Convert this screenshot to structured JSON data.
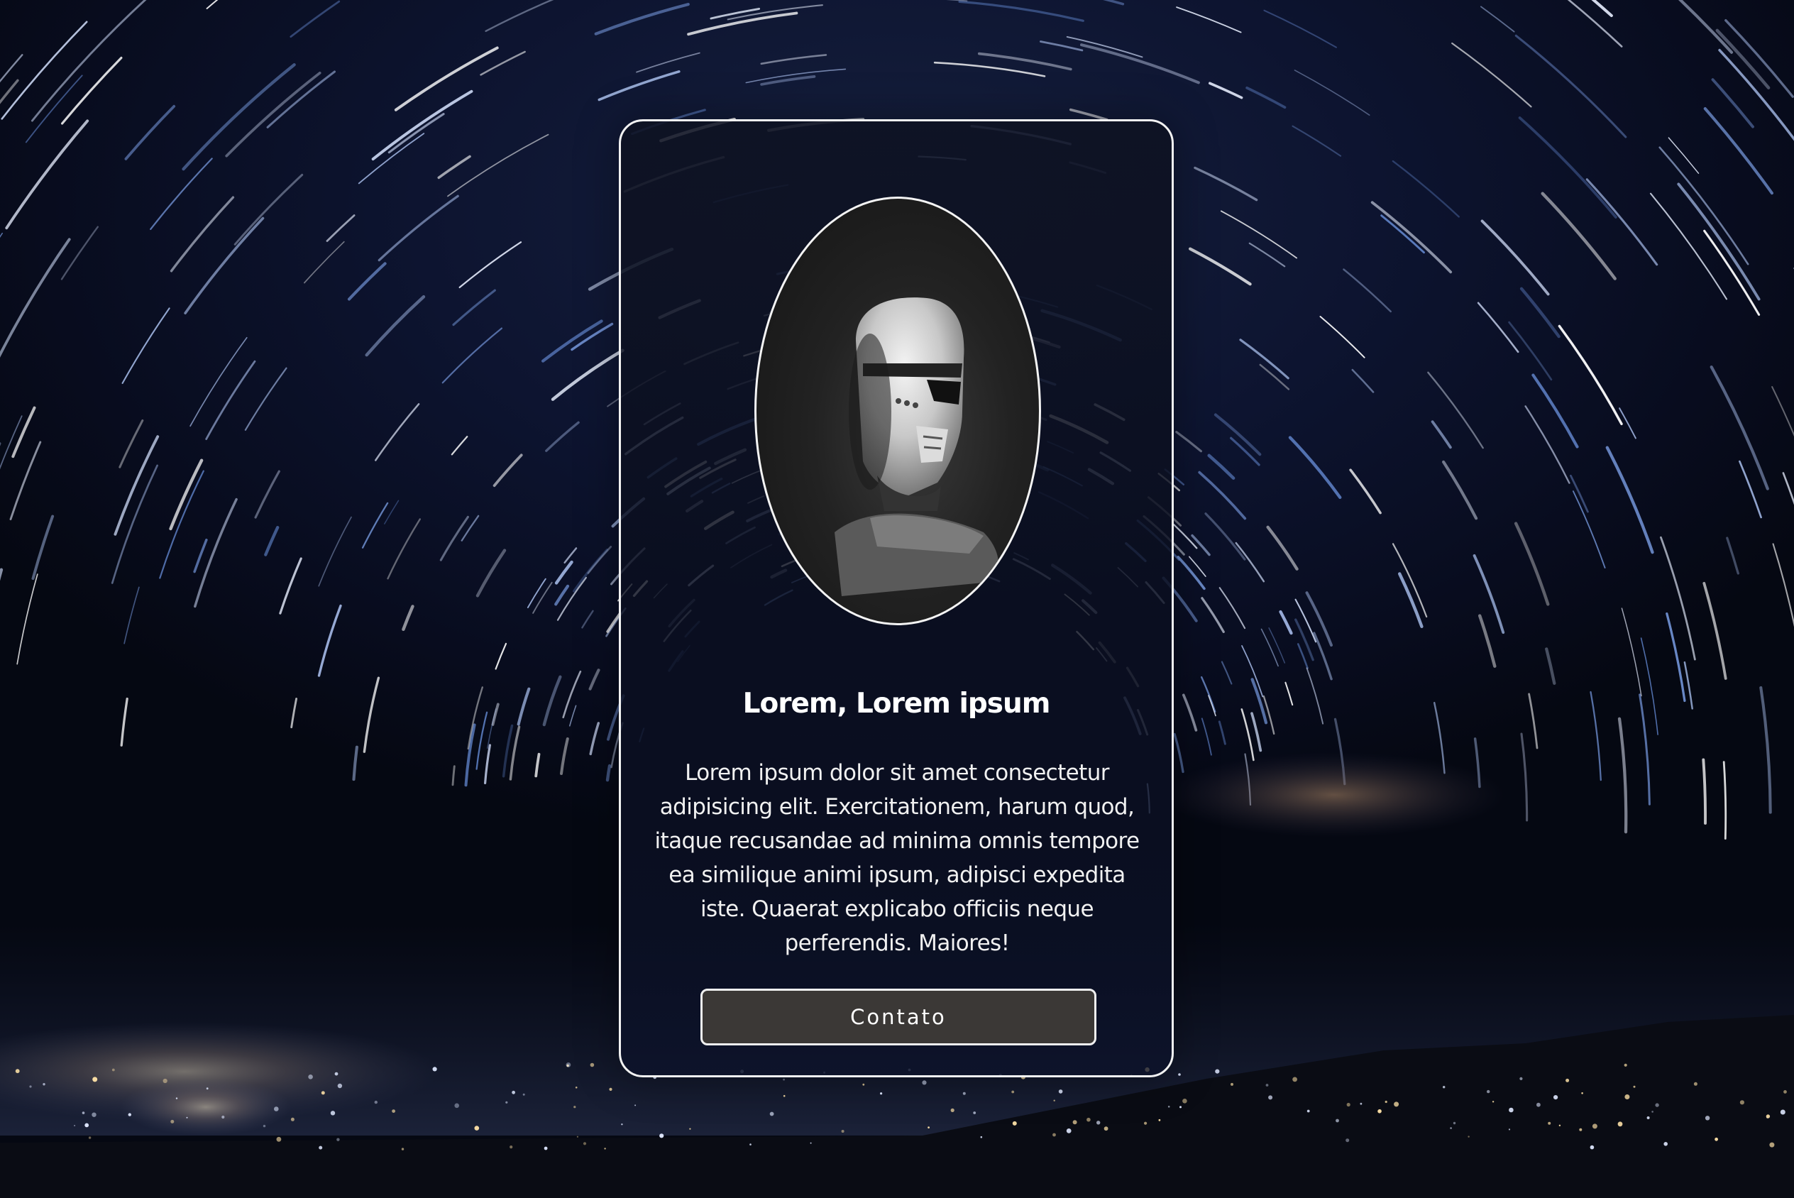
{
  "background": {
    "description_icon": "star-trails-night-sky",
    "colors": {
      "sky": "#0d1430",
      "trails": "#cfd8ee"
    }
  },
  "card": {
    "portrait_icon": "stormtrooper-helmet-photo",
    "title": "Lorem, Lorem ipsum",
    "description": "Lorem ipsum dolor sit amet consectetur adipisicing elit. Exercitationem, harum quod, itaque recusandae ad minima omnis tempore ea similique animi ipsum, adipisci expedita iste. Quaerat explicabo officiis neque perferendis. Maiores!",
    "button_label": "Contato",
    "colors": {
      "border": "#f2f2f2",
      "button_bg": "#3b3836",
      "text": "#ffffff"
    }
  }
}
